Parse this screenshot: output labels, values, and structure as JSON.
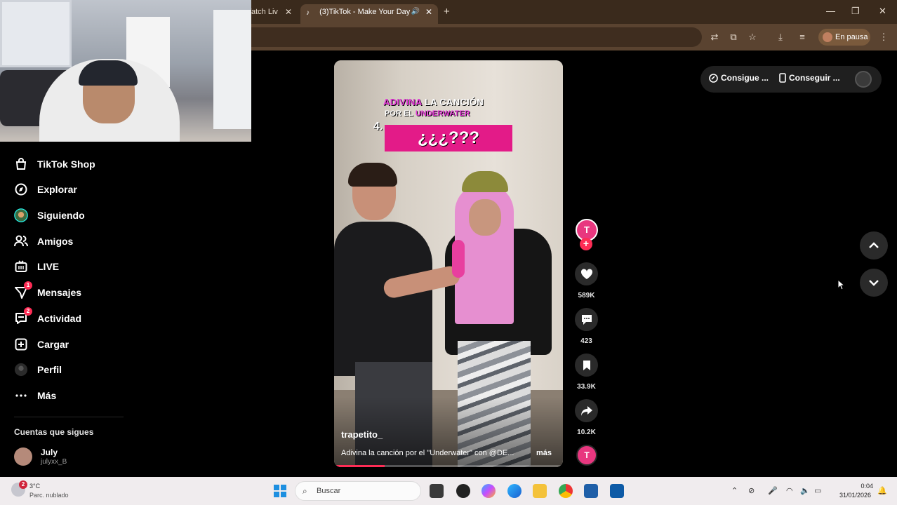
{
  "browser": {
    "tabs": [
      {
        "title": "Watch Liv",
        "active": false
      },
      {
        "title": "(3)TikTok - Make Your Day",
        "active": true
      }
    ],
    "close_glyph": "✕",
    "new_tab_glyph": "+",
    "window_controls": {
      "minimize": "—",
      "restore": "❐",
      "close": "✕"
    },
    "pause_label": "En pausa"
  },
  "sidebar": {
    "items": [
      {
        "label": "TikTok Shop",
        "icon": "shop-bag-icon",
        "badge": ""
      },
      {
        "label": "Explorar",
        "icon": "compass-icon",
        "badge": ""
      },
      {
        "label": "Siguiendo",
        "icon": "following-avatar-icon",
        "badge": ""
      },
      {
        "label": "Amigos",
        "icon": "friends-icon",
        "badge": ""
      },
      {
        "label": "LIVE",
        "icon": "live-tv-icon",
        "badge": ""
      },
      {
        "label": "Mensajes",
        "icon": "send-icon",
        "badge": "1"
      },
      {
        "label": "Actividad",
        "icon": "activity-icon",
        "badge": "2"
      },
      {
        "label": "Cargar",
        "icon": "upload-plus-icon",
        "badge": ""
      },
      {
        "label": "Perfil",
        "icon": "profile-avatar-icon",
        "badge": ""
      },
      {
        "label": "Más",
        "icon": "more-dots-icon",
        "badge": ""
      }
    ],
    "following_title": "Cuentas que sigues",
    "following": [
      {
        "name": "July",
        "handle": "julyxx_B"
      }
    ]
  },
  "video": {
    "caption_line1_a": "ADIVINA",
    "caption_line1_b": " LA CANCIÓN",
    "caption_line2_a": "POR EL ",
    "caption_line2_b": "UNDERWATER",
    "number": "4.",
    "question": "¿¿¿???",
    "author": "trapetito_",
    "description": "Adivina la canción por el \"Underwater\" con @DE...",
    "more_label": "más",
    "progress": 0.22,
    "avatar_letter": "T"
  },
  "actions": {
    "likes": "589K",
    "comments": "423",
    "saves": "33.9K",
    "shares": "10.2K"
  },
  "top_pill": {
    "coins_label": "Consigue ...",
    "app_label": "Conseguir ..."
  },
  "taskbar": {
    "weather_badge": "2",
    "temperature": "3°C",
    "weather_desc": "Parc. nublado",
    "search_placeholder": "Buscar",
    "time": "0:04",
    "date": "31/01/2026"
  },
  "colors": {
    "accent": "#fe2c55",
    "brand_pink": "#e31b88",
    "browser_frame": "#3a2a1c",
    "taskbar": "#f0ecee"
  }
}
